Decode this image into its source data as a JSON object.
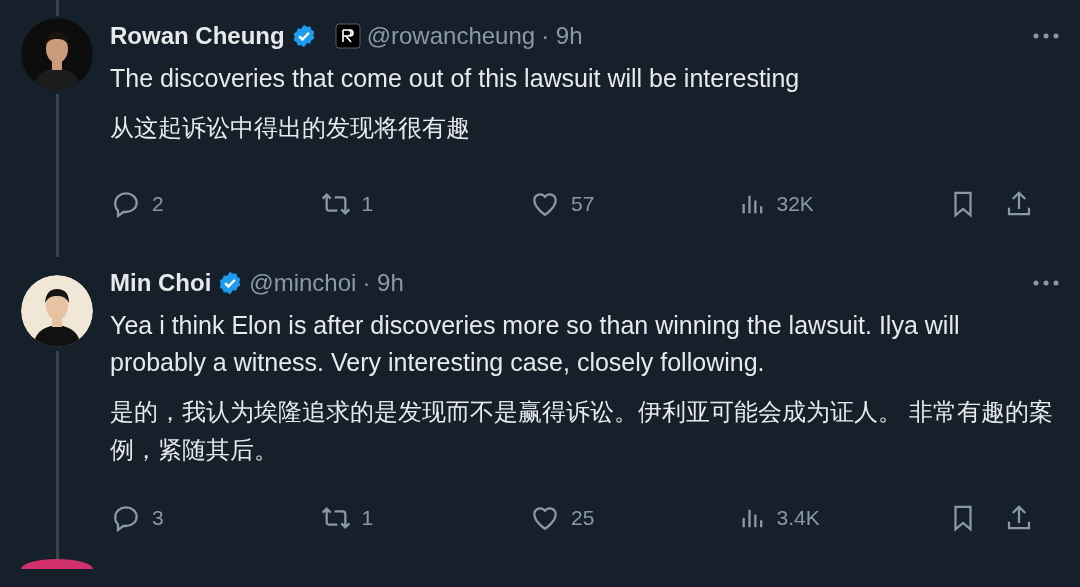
{
  "tweets": [
    {
      "name": "Rowan Cheung",
      "verified": true,
      "affiliate_badge": true,
      "handle": "@rowancheung",
      "time": "· 9h",
      "text": "The discoveries that come out of this lawsuit will be interesting",
      "translation": "从这起诉讼中得出的发现将很有趣",
      "actions": {
        "replies": "2",
        "reposts": "1",
        "likes": "57",
        "views": "32K"
      }
    },
    {
      "name": "Min Choi",
      "verified": true,
      "affiliate_badge": false,
      "handle": "@minchoi",
      "time": "· 9h",
      "text": "Yea i think Elon is after discoveries more so than winning the lawsuit. Ilya will probably a witness.  Very interesting case, closely following.",
      "translation": "是的，我认为埃隆追求的是发现而不是赢得诉讼。伊利亚可能会成为证人。 非常有趣的案例，紧随其后。",
      "actions": {
        "replies": "3",
        "reposts": "1",
        "likes": "25",
        "views": "3.4K"
      }
    }
  ]
}
